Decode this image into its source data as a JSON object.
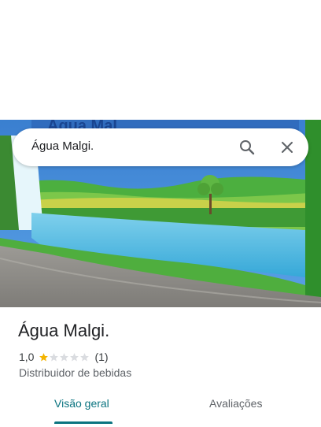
{
  "search": {
    "query": "Água Malgi."
  },
  "place": {
    "name": "Água Malgi.",
    "rating": "1,0",
    "rating_fraction": 0.2,
    "review_count": "(1)",
    "category": "Distribuidor de bebidas"
  },
  "tabs": {
    "overview": "Visão geral",
    "reviews": "Avaliações"
  },
  "colors": {
    "accent": "#0b7480",
    "star_filled": "#f4b400",
    "star_empty": "#dadce0"
  },
  "icons": {
    "search": "search-icon",
    "close": "close-icon",
    "star": "star-icon"
  }
}
